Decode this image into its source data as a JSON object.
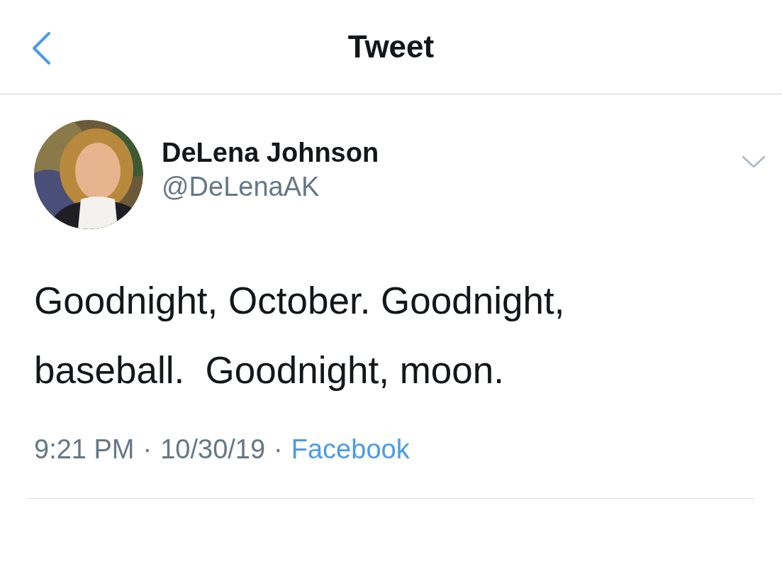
{
  "header": {
    "title": "Tweet"
  },
  "tweet": {
    "author": {
      "name": "DeLena Johnson",
      "handle": "@DeLenaAK"
    },
    "text": "Goodnight, October. Goodnight, baseball.  Goodnight, moon.",
    "meta": [
      {
        "kind": "text",
        "text": "9:21 PM"
      },
      {
        "kind": "separator",
        "text": "·"
      },
      {
        "kind": "text",
        "text": "10/30/19"
      },
      {
        "kind": "separator",
        "text": "·"
      },
      {
        "kind": "link",
        "text": "Facebook"
      }
    ]
  }
}
